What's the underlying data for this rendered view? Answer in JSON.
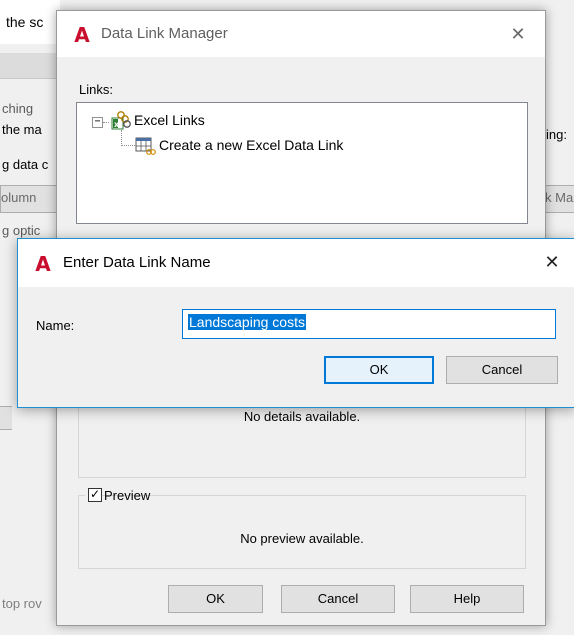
{
  "background": {
    "title_fragment": "the sc",
    "lines": [
      "ching",
      "the ma",
      "g data c",
      "ing:",
      "olumn",
      "k Ma",
      "g optic",
      "top rov"
    ]
  },
  "manager": {
    "title": "Data Link Manager",
    "links_label": "Links:",
    "tree": {
      "root": "Excel Links",
      "child": "Create a new Excel Data Link"
    },
    "details_text": "No details available.",
    "preview_label": "Preview",
    "preview_checked": true,
    "preview_text": "No preview available.",
    "buttons": {
      "ok": "OK",
      "cancel": "Cancel",
      "help": "Help"
    }
  },
  "name_dialog": {
    "title": "Enter Data Link Name",
    "name_label": "Name:",
    "name_value": "Landscaping costs",
    "buttons": {
      "ok": "OK",
      "cancel": "Cancel"
    }
  },
  "icons": {
    "app_logo": "autocad-logo-icon",
    "close": "close-icon",
    "excel_links": "excel-links-icon",
    "new_excel_link": "excel-table-link-icon"
  },
  "colors": {
    "accent": "#0078d7",
    "logo_red": "#c8102e",
    "dialog_border": "#1e8fd0"
  }
}
